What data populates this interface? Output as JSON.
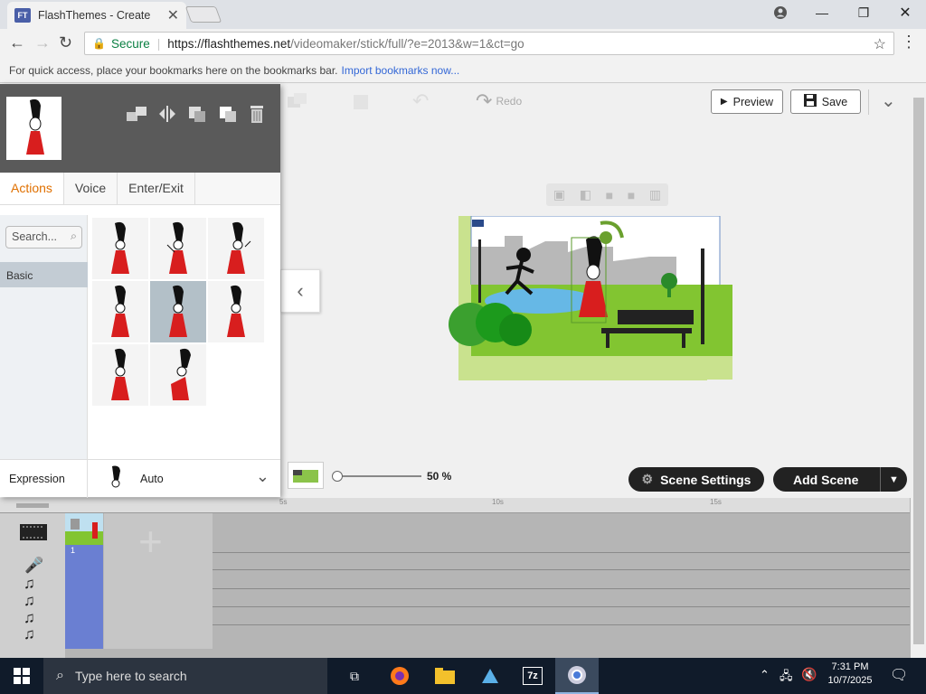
{
  "browser": {
    "tab_title": "FlashThemes - Create",
    "favicon_text": "FT",
    "secure_label": "Secure",
    "url_host": "https://flashthemes.net",
    "url_rest": "/videomaker/stick/full/?e=2013&w=1&ct=go",
    "bookmarks_hint": "For quick access, place your bookmarks here on the bookmarks bar.",
    "import_link": "Import bookmarks now..."
  },
  "toolbar": {
    "redo_label": "Redo",
    "preview_label": "Preview",
    "save_label": "Save"
  },
  "panel": {
    "tabs": [
      {
        "label": "Actions"
      },
      {
        "label": "Voice"
      },
      {
        "label": "Enter/Exit"
      }
    ],
    "search_placeholder": "Search...",
    "category": "Basic",
    "expression_label": "Expression",
    "expression_value": "Auto"
  },
  "zoom": {
    "percent": "50 %"
  },
  "scene": {
    "settings_label": "Scene Settings",
    "add_label": "Add Scene",
    "number": "1"
  },
  "timeline": {
    "ticks": [
      "5s",
      "10s",
      "15s"
    ]
  },
  "taskbar": {
    "search_placeholder": "Type here to search",
    "time": "7:31 PM",
    "date": "10/7/2025",
    "archive_label": "7z"
  },
  "colors": {
    "accent_orange": "#e07000",
    "secure_green": "#0b8043",
    "scene_blue": "#6a7fd2",
    "grass": "#7cc12b"
  }
}
